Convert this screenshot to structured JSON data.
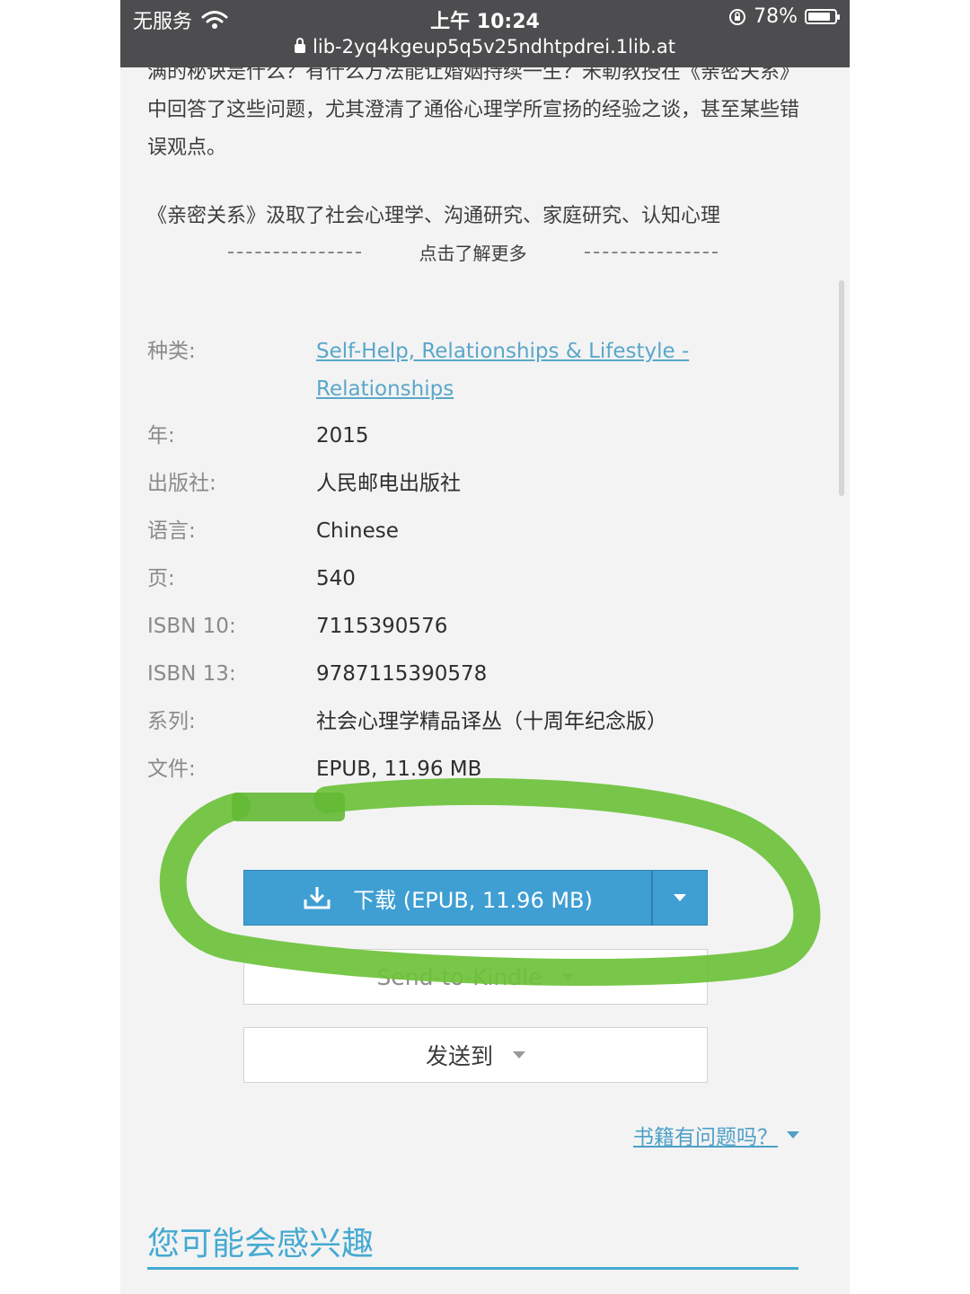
{
  "status_bar": {
    "carrier": "无服务",
    "time": "上午 10:24",
    "battery": "78%"
  },
  "address_bar": {
    "url": "lib-2yq4kgeup5q5v25ndhtpdrei.1lib.at"
  },
  "description": {
    "paragraph1": "满的秘诀是什么？有什么方法能让婚姻持续一生？米勒教授在《亲密关系》中回答了这些问题，尤其澄清了通俗心理学所宣扬的经验之谈，甚至某些错误观点。",
    "paragraph2": "《亲密关系》汲取了社会心理学、沟通研究、家庭研究、认知心理",
    "read_more": "点击了解更多"
  },
  "details": {
    "category": {
      "label": "种类:",
      "value": "Self-Help, Relationships & Lifestyle - Relationships"
    },
    "year": {
      "label": "年:",
      "value": "2015"
    },
    "publisher": {
      "label": "出版社:",
      "value": "人民邮电出版社"
    },
    "language": {
      "label": "语言:",
      "value": "Chinese"
    },
    "pages": {
      "label": "页:",
      "value": "540"
    },
    "isbn10": {
      "label": "ISBN 10:",
      "value": "7115390576"
    },
    "isbn13": {
      "label": "ISBN 13:",
      "value": "9787115390578"
    },
    "series": {
      "label": "系列:",
      "value": "社会心理学精品译丛（十周年纪念版）"
    },
    "file": {
      "label": "文件:",
      "value": "EPUB, 11.96 MB"
    }
  },
  "actions": {
    "download": "下载 (EPUB, 11.96 MB)",
    "send_to_kindle": "Send-to-Kindle",
    "send_to": "发送到",
    "report": "书籍有问题吗？"
  },
  "section": {
    "interest_title": "您可能会感兴趣"
  },
  "colors": {
    "accent": "#3f9fd3",
    "link": "#5aa7c9",
    "highlight": "#6cc23a",
    "topbar": "#4d4d4f"
  }
}
